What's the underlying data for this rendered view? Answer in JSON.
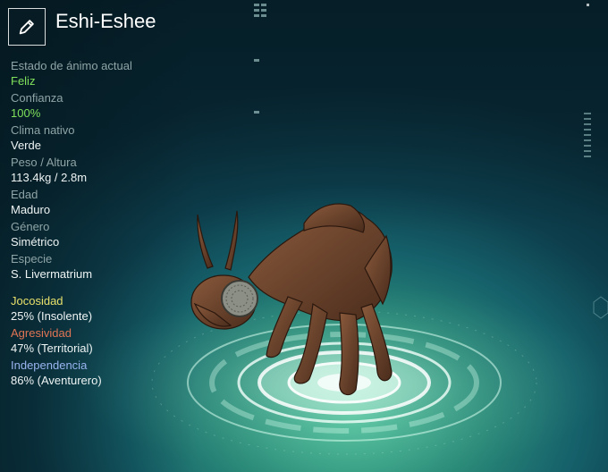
{
  "header": {
    "name": "Eshi-Eshee",
    "edit_icon": "pencil-icon"
  },
  "stats": [
    {
      "label": "Estado de ánimo actual",
      "value": "Feliz",
      "highlight": true
    },
    {
      "label": "Confianza",
      "value": "100%",
      "highlight": true
    },
    {
      "label": "Clima nativo",
      "value": "Verde",
      "highlight": false
    },
    {
      "label": "Peso / Altura",
      "value": "113.4kg / 2.8m",
      "highlight": false
    },
    {
      "label": "Edad",
      "value": "Maduro",
      "highlight": false
    },
    {
      "label": "Género",
      "value": "Simétrico",
      "highlight": false
    },
    {
      "label": "Especie",
      "value": "S. Livermatrium",
      "highlight": false
    }
  ],
  "personality": {
    "playfulness": {
      "label": "Jocosidad",
      "value": "25% (Insolente)",
      "color": "#e8e06a"
    },
    "aggression": {
      "label": "Agresividad",
      "value": "47% (Territorial)",
      "color": "#e07454"
    },
    "independence": {
      "label": "Independencia",
      "value": "86% (Aventurero)",
      "color": "#9ab4f0"
    }
  },
  "colors": {
    "highlight_green": "#7fe05a",
    "label_grey": "#8fa4a6",
    "platform_glow": "#cff5e6"
  }
}
